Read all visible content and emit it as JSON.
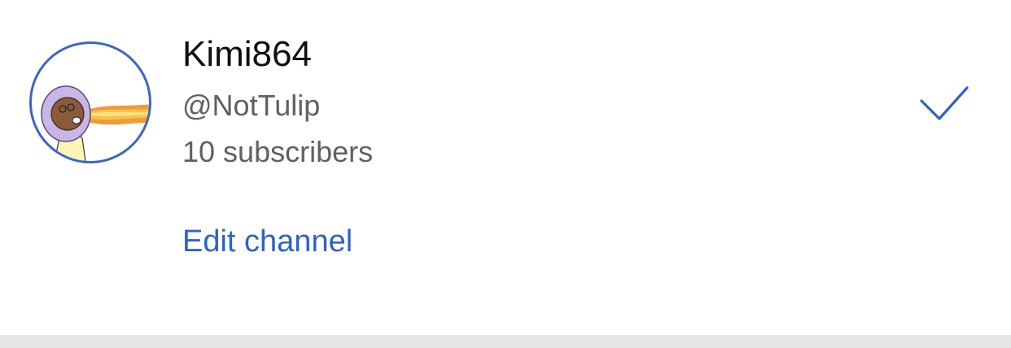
{
  "account": {
    "name": "Kimi864",
    "handle": "@NotTulip",
    "subscribers": "10 subscribers",
    "edit_label": "Edit channel",
    "selected": true
  },
  "colors": {
    "link": "#2d63c8",
    "avatar_ring": "#3a66c4",
    "checkmark": "#2d63c8",
    "secondary_text": "#606060",
    "primary_text": "#0f0f0f",
    "divider": "#e5e5e5"
  },
  "icons": {
    "avatar": "avatar-cartoon-fire-breath",
    "selected": "check-icon"
  }
}
